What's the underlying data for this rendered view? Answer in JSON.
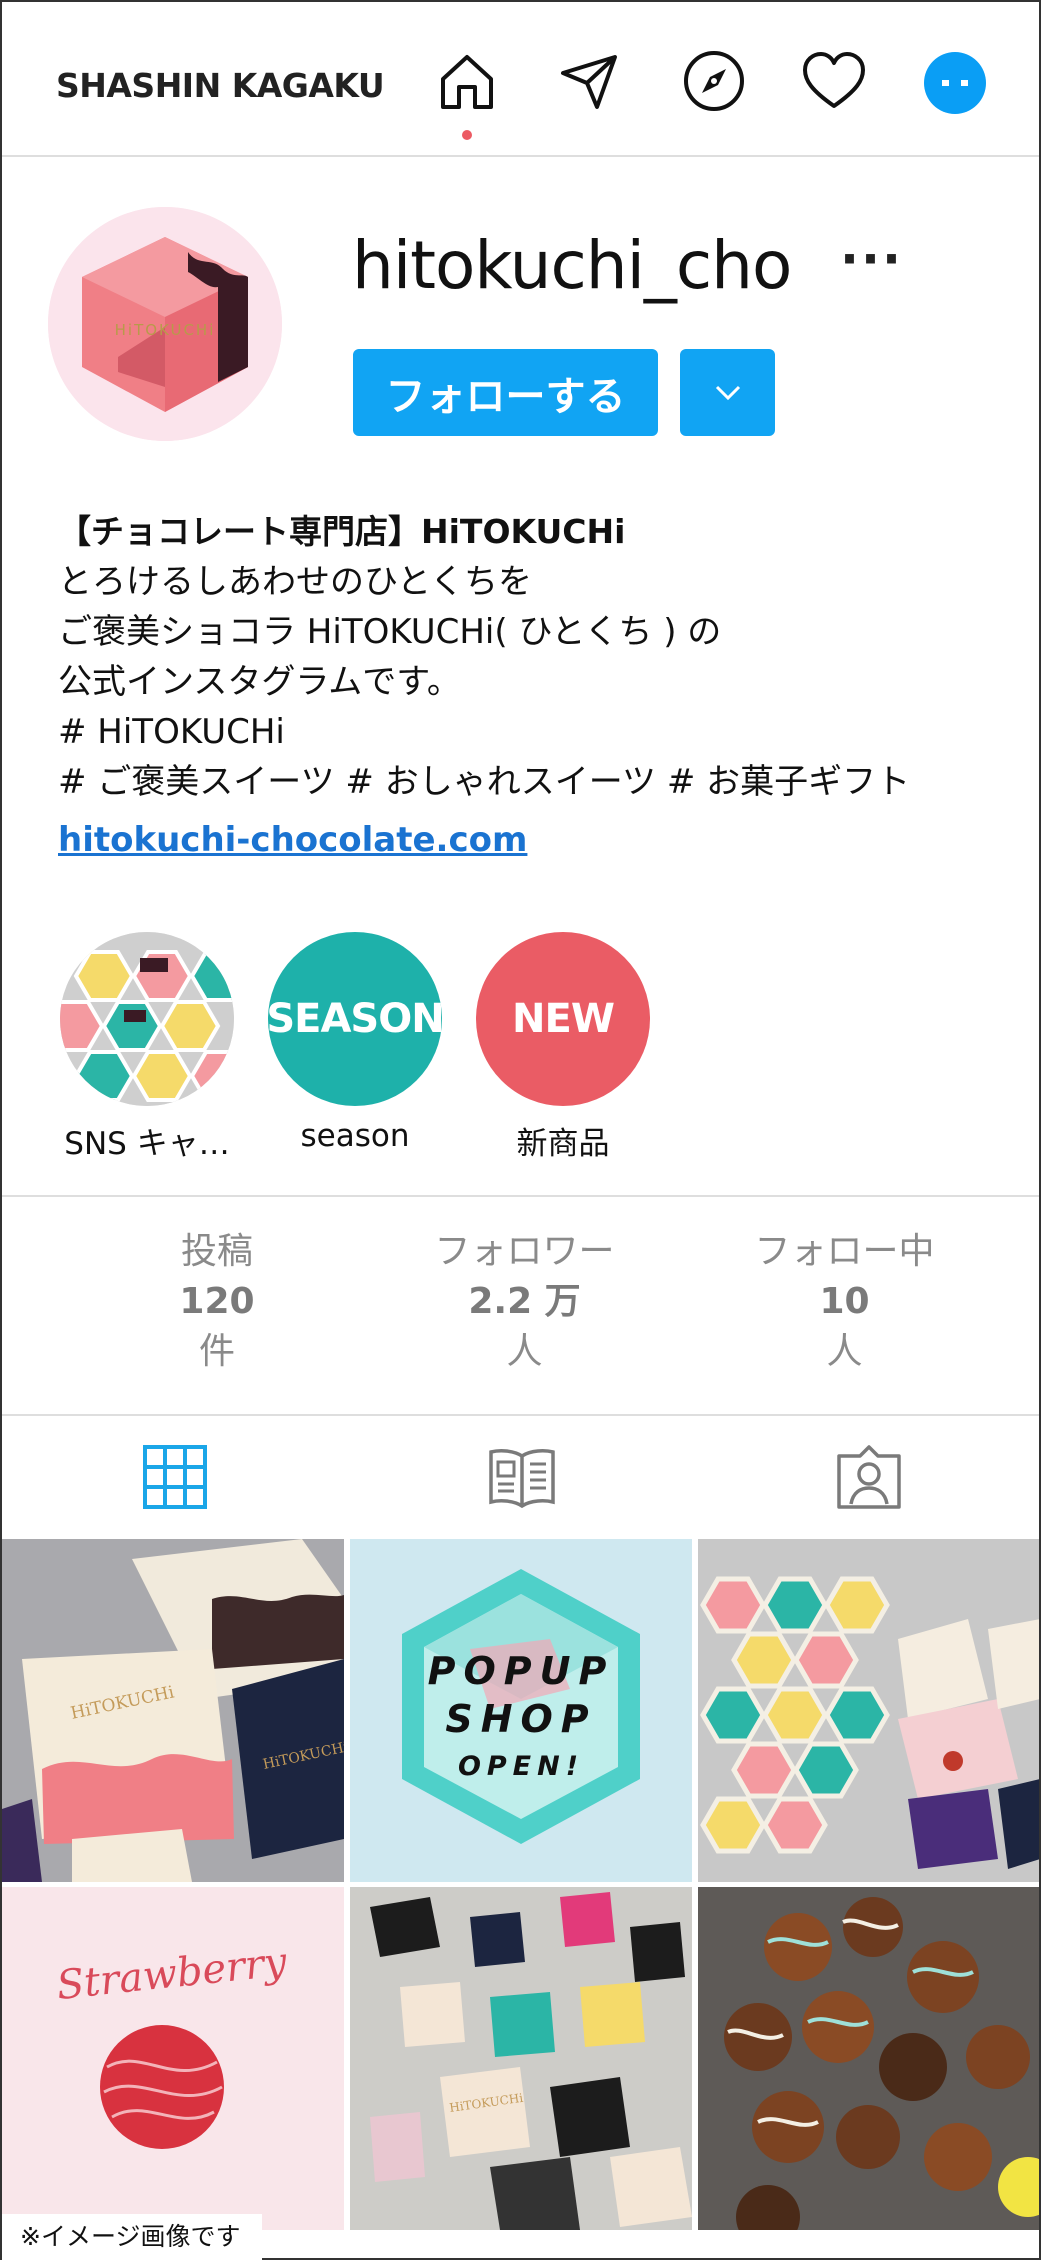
{
  "header": {
    "brand": "SHASHIN KAGAKU",
    "nav_icons": [
      "home-icon",
      "send-icon",
      "explore-icon",
      "heart-icon",
      "avatar-icon"
    ],
    "accent": "#0a9ef5",
    "active_dot_color": "#ec5a63"
  },
  "profile": {
    "username": "hitokuchi_cho",
    "more": "···",
    "follow_label": "フォローする",
    "dropdown_icon": "chevron-down-icon",
    "avatar_text": "HiTOKUCHi"
  },
  "bio": {
    "title": "【チョコレート専門店】HiTOKUCHi",
    "lines": [
      "とろけるしあわせのひとくちを",
      "ご褒美ショコラ HiTOKUCHi( ひとくち ) の",
      "公式インスタグラムです。",
      "# HiTOKUCHi",
      "# ご褒美スイーツ # おしゃれスイーツ # お菓子ギフト"
    ],
    "link": "hitokuchi-chocolate.com"
  },
  "highlights": [
    {
      "label": "SNS キャ…",
      "text": "",
      "color": "#e6e6e6"
    },
    {
      "label": "season",
      "text": "SEASON",
      "color": "#1eb1aa"
    },
    {
      "label": "新商品",
      "text": "NEW",
      "color": "#ea5c65"
    }
  ],
  "stats": [
    {
      "label": "投稿",
      "value": "120",
      "unit": "件"
    },
    {
      "label": "フォロワー",
      "value": "2.2 万",
      "unit": "人"
    },
    {
      "label": "フォロー中",
      "value": "10",
      "unit": "人"
    }
  ],
  "tabs": [
    "grid-icon",
    "guide-icon",
    "tagged-icon"
  ],
  "posts": {
    "popup": [
      "POPUP",
      "SHOP",
      "OPEN!"
    ],
    "strawberry": "Strawberry",
    "box_text": "HiTOKUCHi"
  },
  "caption": "※イメージ画像です"
}
